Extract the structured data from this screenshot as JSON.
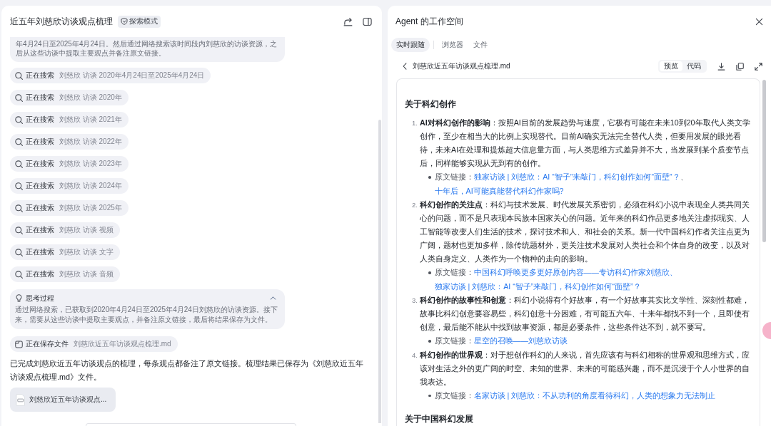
{
  "chat": {
    "title": "近五年刘慈欣访谈观点梳理",
    "mode_badge": "探索模式",
    "plan_excerpt": "年4月24日至2025年4月24日。然后通过网络搜索该时间段内刘慈欣的访谈资源，之后从这些访谈中提取主要观点并备注原文链接。",
    "steps": [
      {
        "kind": "search",
        "label": "正在搜索",
        "detail": "刘慈欣 访谈 2020年4月24日至2025年4月24日"
      },
      {
        "kind": "search",
        "label": "正在搜索",
        "detail": "刘慈欣 访谈 2020年"
      },
      {
        "kind": "search",
        "label": "正在搜索",
        "detail": "刘慈欣 访谈 2021年"
      },
      {
        "kind": "search",
        "label": "正在搜索",
        "detail": "刘慈欣 访谈 2022年"
      },
      {
        "kind": "search",
        "label": "正在搜索",
        "detail": "刘慈欣 访谈 2023年"
      },
      {
        "kind": "search",
        "label": "正在搜索",
        "detail": "刘慈欣 访谈 2024年"
      },
      {
        "kind": "search",
        "label": "正在搜索",
        "detail": "刘慈欣 访谈 2025年"
      },
      {
        "kind": "search",
        "label": "正在搜索",
        "detail": "刘慈欣 访谈 视频"
      },
      {
        "kind": "search",
        "label": "正在搜索",
        "detail": "刘慈欣 访谈 文字"
      },
      {
        "kind": "search",
        "label": "正在搜索",
        "detail": "刘慈欣 访谈 音频"
      },
      {
        "kind": "thinking",
        "label": "思考过程",
        "detail": "通过网络搜索，已获取到2020年4月24日至2025年4月24日刘慈欣的访谈资源。接下来，需要从这些访谈中提取主要观点，并备注原文链接，最后将结果保存为文件。",
        "expanded": true
      },
      {
        "kind": "save",
        "label": "正在保存文件",
        "detail": "刘慈欣近五年访谈观点梳理.md"
      }
    ],
    "reply": "已完成刘慈欣近五年访谈观点的梳理，每条观点都备注了原文链接。梳理结果已保存为《刘慈欣近五年访谈观点梳理.md》文件。",
    "attachment": {
      "name": "刘慈欣近五年访谈观点..."
    }
  },
  "workspace": {
    "title": "Agent 的工作空间",
    "tabs": [
      {
        "label": "实时跟随",
        "selected": true
      },
      {
        "label": "浏览器",
        "selected": false
      },
      {
        "label": "文件",
        "selected": false
      }
    ],
    "file": {
      "name": "刘慈欣近五年访谈观点梳理.md",
      "view_modes": [
        {
          "label": "预览",
          "selected": true
        },
        {
          "label": "代码",
          "selected": false
        }
      ]
    },
    "document": {
      "sections": [
        {
          "heading": "关于科幻创作",
          "items": [
            {
              "number": "1.",
              "text": "**AI对科幻创作的影响**：按照AI目前的发展趋势与速度，它极有可能在未来10到20年取代人类文学创作，至少在相当大的比例上实现替代。目前AI确实无法完全替代人类，但要用发展的眼光看待，未来AI在处理和提炼超大信息量方面，与人类思维方式差异并不大，当发展到某个质变节点后，同样能够实现从无到有的创作。",
              "source": {
                "label": "原文链接：",
                "parts": [
                  {
                    "kind": "link",
                    "text": "独家访谈 | 刘慈欣：AI “智子”来敲门，科幻创作如何“面壁”？"
                  },
                  {
                    "kind": "text",
                    "text": "、"
                  },
                  {
                    "kind": "link",
                    "text": "十年后，AI可能真能替代科幻作家吗?"
                  }
                ]
              }
            },
            {
              "number": "2.",
              "text": "**科幻创作的关注点**：科幻与技术发展、时代发展关系密切，必须在科幻小说中表现全人类共同关心的问题，而不是只表现本民族本国家关心的问题。近年来的科幻作品更多地关注虚拟现实、人工智能等改变人们生活的技术，探讨技术和人、和社会的关系。新一代中国科幻作者关注点更为广阔，题材也更加多样，除传统题材外，更关注技术发展对人类社会和个体自身的改变，以及对人类自身定义、人类作为一个物种的走向的影响。",
              "source": {
                "label": "原文链接：",
                "parts": [
                  {
                    "kind": "link",
                    "text": "中国科幻呼唤更多更好原创内容——专访科幻作家刘慈欣、"
                  },
                  {
                    "kind": "link",
                    "text": "独家访谈 | 刘慈欣：AI “智子”来敲门，科幻创作如何“面壁”？"
                  }
                ]
              }
            },
            {
              "number": "3.",
              "text": "**科幻创作的故事性和创意**：科幻小说得有个好故事，有一个好故事其实比文学性、深刻性都难，故事比科幻创意要容易些，科幻创意十分困难，有可能五六年、十来年都找不到一个，且即使有创意，最后能不能从中找到故事资源，都是必要条件，这些条件达不到，就不要写。",
              "source": {
                "label": "原文链接：",
                "parts": [
                  {
                    "kind": "link",
                    "text": "星空的召唤——刘慈欣访谈"
                  }
                ]
              }
            },
            {
              "number": "4.",
              "text": "**科幻创作的世界观**：对于想创作科幻的人来说，首先应该有与科幻相称的世界观和思维方式，应该对生活之外的更广阔的时空、未知的世界、未来的可能感兴趣，而不是沉浸于个人小世界的自我表达。",
              "source": {
                "label": "原文链接：",
                "parts": [
                  {
                    "kind": "link",
                    "text": "名家访谈 | 刘慈欣：不从功利的角度看待科幻，人类的想象力无法制止"
                  }
                ]
              }
            }
          ]
        },
        {
          "heading": "关于中国科幻发展"
        }
      ]
    }
  }
}
